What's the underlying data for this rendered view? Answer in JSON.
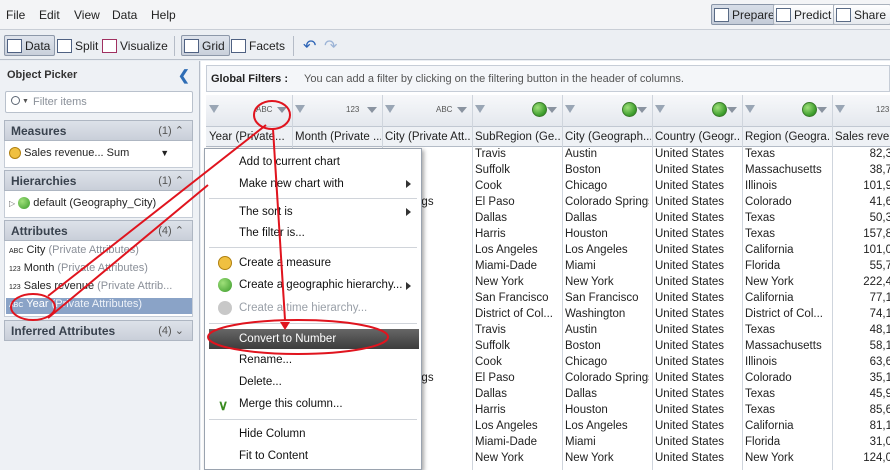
{
  "menubar": {
    "items": [
      "File",
      "Edit",
      "View",
      "Data",
      "Help"
    ]
  },
  "modes": {
    "prepare": "Prepare",
    "predict": "Predict",
    "share": "Share"
  },
  "toolbar": {
    "data": "Data",
    "split": "Split",
    "visualize": "Visualize",
    "grid": "Grid",
    "facets": "Facets"
  },
  "left": {
    "title": "Object Picker",
    "filter_placeholder": "Filter items",
    "measures": {
      "title": "Measures",
      "count": "(1)",
      "item": "Sales revenue... Sum"
    },
    "hierarchies": {
      "title": "Hierarchies",
      "count": "(1)",
      "item": "default (Geography_City)"
    },
    "attributes": {
      "title": "Attributes",
      "count": "(4)",
      "items": [
        {
          "name": "City",
          "kind": "(Private Attributes)"
        },
        {
          "name": "Month",
          "kind": "(Private Attributes)"
        },
        {
          "name": "Sales revenue",
          "kind": "(Private Attrib..."
        },
        {
          "name": "Year",
          "kind": "(Private Attributes)"
        }
      ]
    },
    "inferred": {
      "title": "Inferred Attributes",
      "count": "(4)"
    }
  },
  "global_filters": {
    "title": "Global Filters :",
    "desc": "You can add a filter by clicking on the filtering button in the header of columns."
  },
  "columns": [
    "Year (Private...",
    "Month (Private ...",
    "City (Private Att...",
    "SubRegion (Ge...",
    "City (Geograph...",
    "Country (Geogr...",
    "Region (Geogra...",
    "Sales revenu"
  ],
  "rows": [
    [
      "",
      "",
      "",
      "Travis",
      "Austin",
      "United States",
      "Texas",
      "82,3"
    ],
    [
      "",
      "",
      "",
      "Suffolk",
      "Boston",
      "United States",
      "Massachusetts",
      "38,7"
    ],
    [
      "",
      "",
      "",
      "Cook",
      "Chicago",
      "United States",
      "Illinois",
      "101,9"
    ],
    [
      "",
      "",
      "o Springs",
      "El Paso",
      "Colorado Springs",
      "United States",
      "Colorado",
      "41,6"
    ],
    [
      "",
      "",
      "",
      "Dallas",
      "Dallas",
      "United States",
      "Texas",
      "50,3"
    ],
    [
      "",
      "",
      "n",
      "Harris",
      "Houston",
      "United States",
      "Texas",
      "157,8"
    ],
    [
      "",
      "",
      "eles",
      "Los Angeles",
      "Los Angeles",
      "United States",
      "California",
      "101,0"
    ],
    [
      "",
      "",
      "",
      "Miami-Dade",
      "Miami",
      "United States",
      "Florida",
      "55,7"
    ],
    [
      "",
      "",
      "rk",
      "New York",
      "New York",
      "United States",
      "New York",
      "222,4"
    ],
    [
      "",
      "",
      "ncisco",
      "San Francisco",
      "San Francisco",
      "United States",
      "California",
      "77,1"
    ],
    [
      "",
      "",
      "gton",
      "District of Col...",
      "Washington",
      "United States",
      "District of Col...",
      "74,1"
    ],
    [
      "",
      "",
      "",
      "Travis",
      "Austin",
      "United States",
      "Texas",
      "48,1"
    ],
    [
      "",
      "",
      "",
      "Suffolk",
      "Boston",
      "United States",
      "Massachusetts",
      "58,1"
    ],
    [
      "",
      "",
      "",
      "Cook",
      "Chicago",
      "United States",
      "Illinois",
      "63,6"
    ],
    [
      "",
      "",
      "o Springs",
      "El Paso",
      "Colorado Springs",
      "United States",
      "Colorado",
      "35,1"
    ],
    [
      "",
      "",
      "",
      "Dallas",
      "Dallas",
      "United States",
      "Texas",
      "45,9"
    ],
    [
      "",
      "",
      "n",
      "Harris",
      "Houston",
      "United States",
      "Texas",
      "85,6"
    ],
    [
      "",
      "",
      "eles",
      "Los Angeles",
      "Los Angeles",
      "United States",
      "California",
      "81,1"
    ],
    [
      "",
      "",
      "",
      "Miami-Dade",
      "Miami",
      "United States",
      "Florida",
      "31,0"
    ],
    [
      "",
      "",
      "rk",
      "New York",
      "New York",
      "United States",
      "New York",
      "124,0"
    ]
  ],
  "context_menu": {
    "add_to_chart": "Add to current chart",
    "make_chart": "Make new chart with",
    "sort": "The sort is",
    "filter": "The filter is...",
    "create_measure": "Create a measure",
    "create_geo": "Create a geographic hierarchy...",
    "create_time": "Create a time hierarchy...",
    "convert": "Convert to Number",
    "rename": "Rename...",
    "delete": "Delete...",
    "merge": "Merge this column...",
    "hide": "Hide Column",
    "fit": "Fit to Content"
  },
  "colors": {
    "annotation": "#e0141e",
    "selection": "#8aa3c7",
    "highlight": "#4a4a4a"
  }
}
